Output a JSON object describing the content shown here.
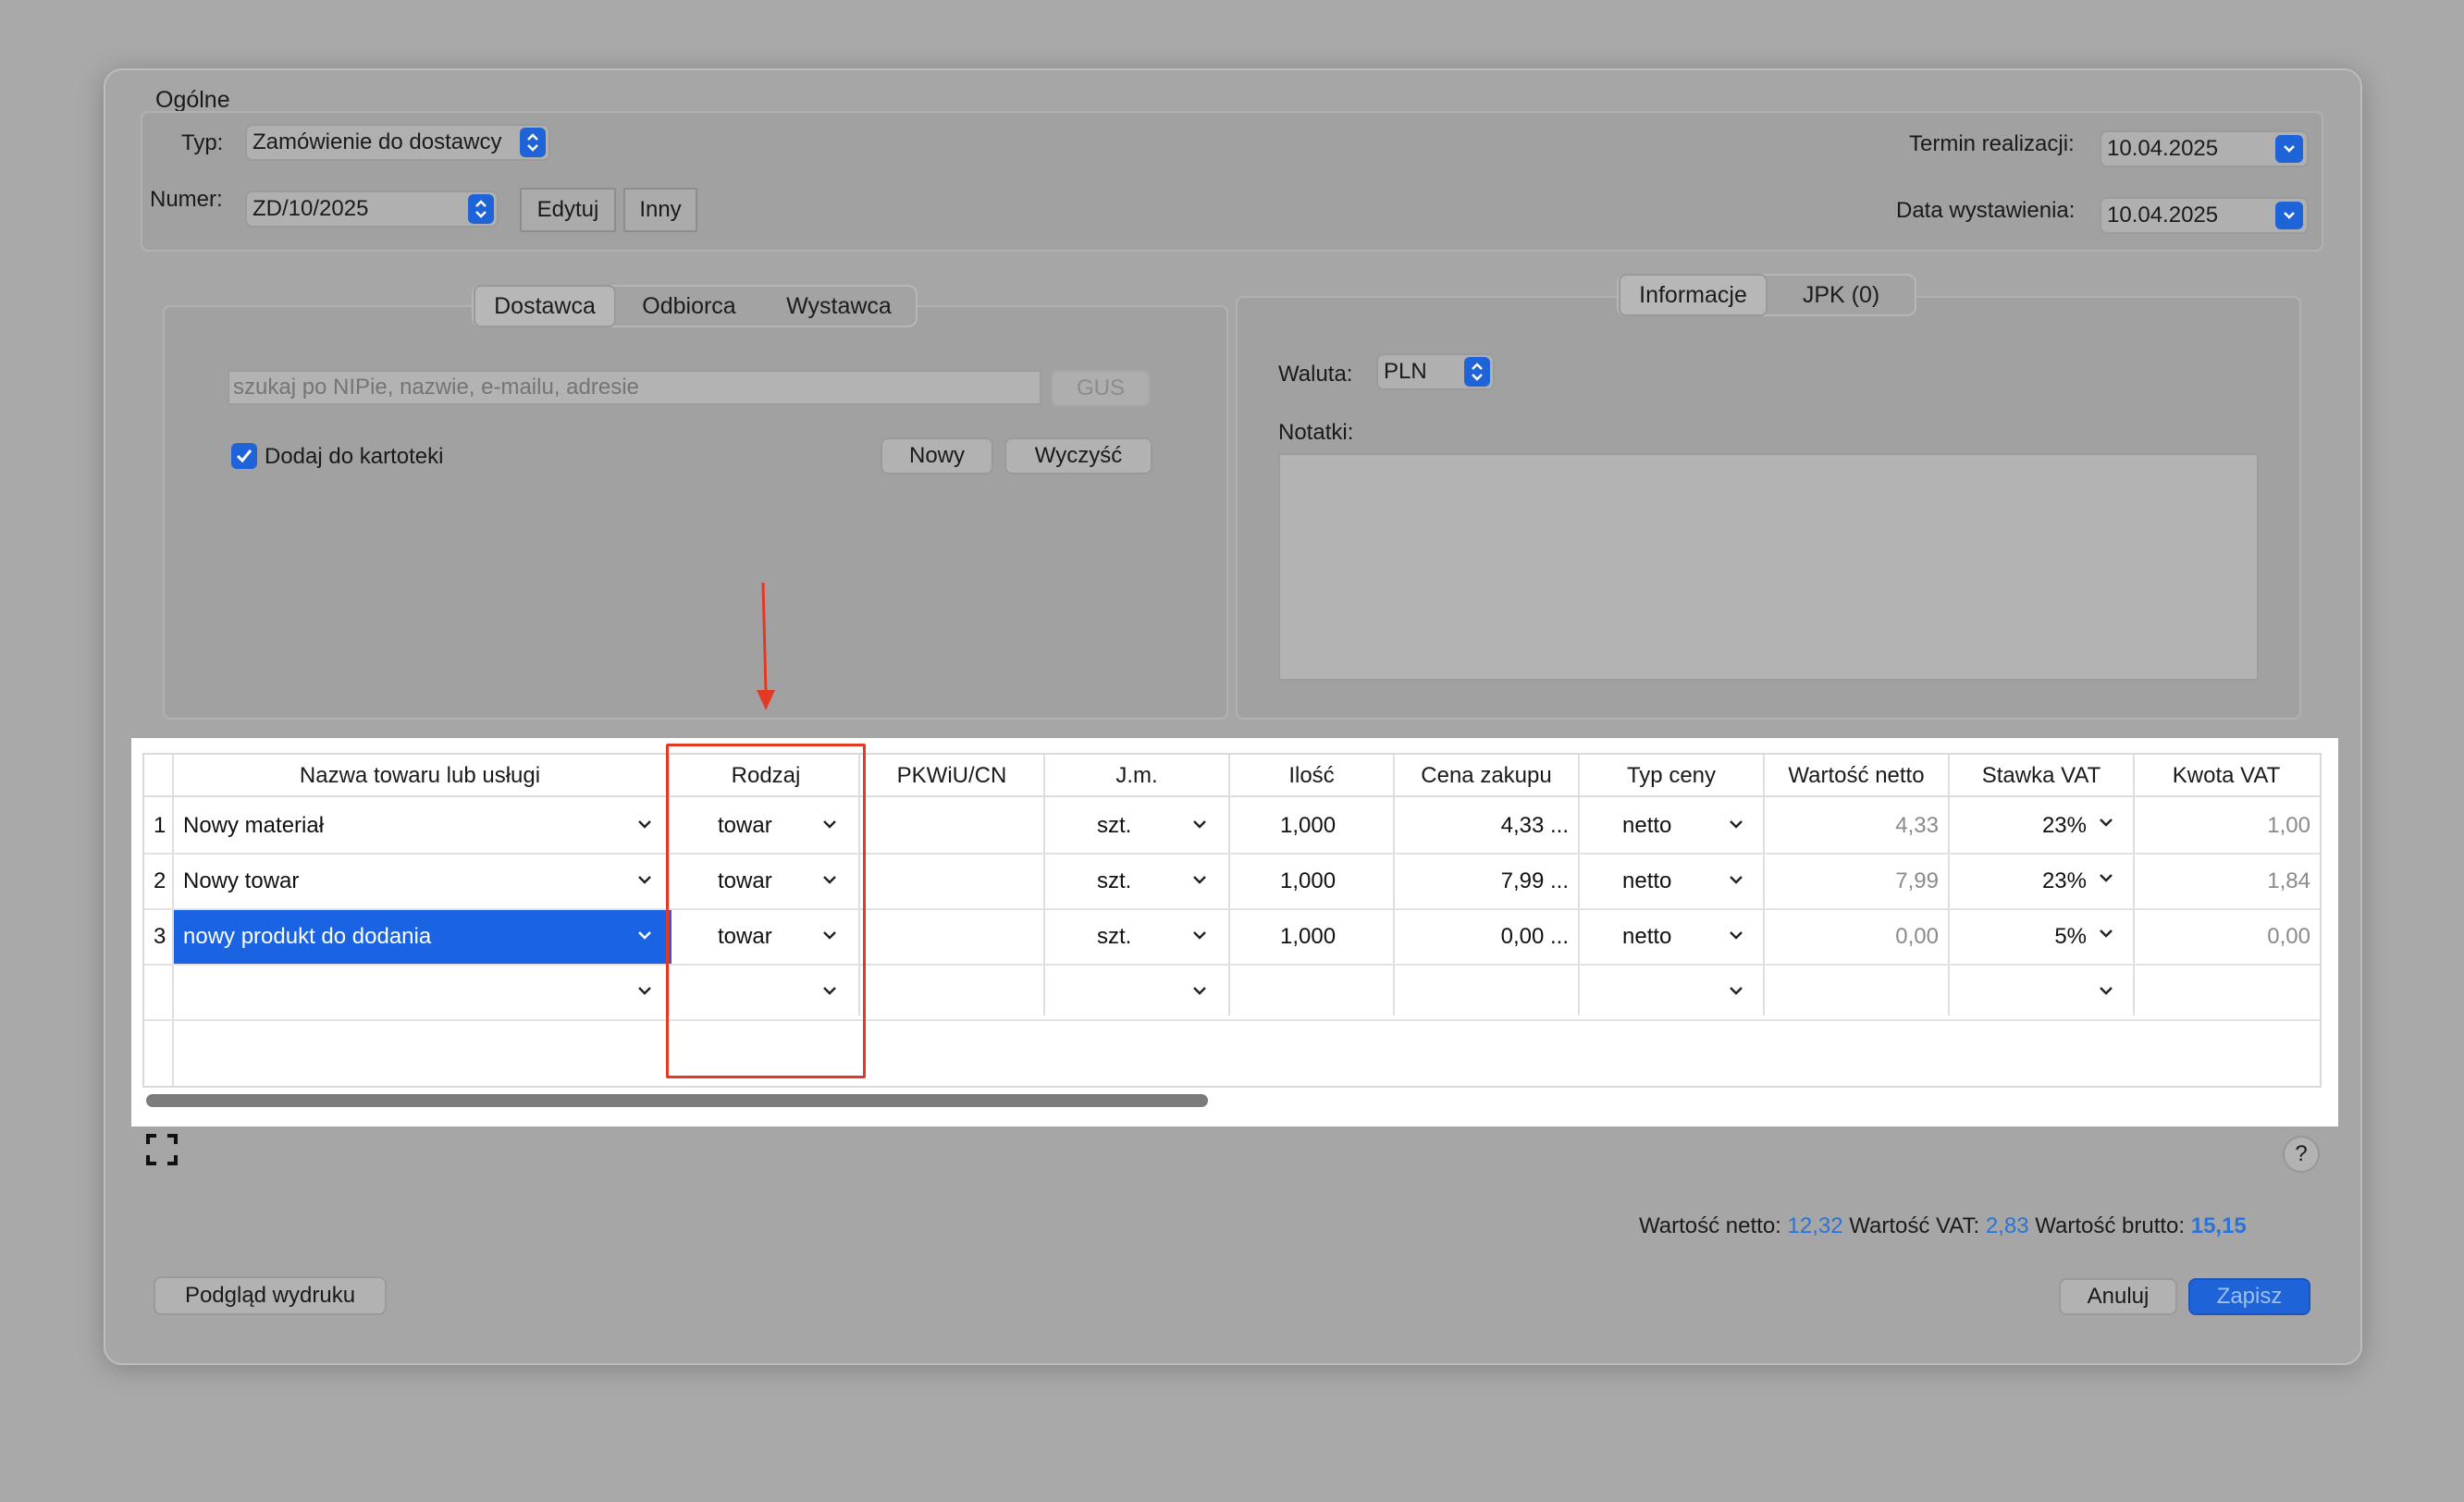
{
  "general": {
    "section_title": "Ogólne",
    "typ_label": "Typ:",
    "typ_value": "Zamówienie do dostawcy",
    "numer_label": "Numer:",
    "numer_value": "ZD/10/2025",
    "edytuj_label": "Edytuj",
    "inny_label": "Inny",
    "termin_label": "Termin realizacji:",
    "termin_value": "10.04.2025",
    "data_wyst_label": "Data wystawienia:",
    "data_wyst_value": "10.04.2025"
  },
  "party_tabs": [
    "Dostawca",
    "Odbiorca",
    "Wystawca"
  ],
  "party": {
    "search_placeholder": "szukaj po NIPie, nazwie, e-mailu, adresie",
    "gus_label": "GUS",
    "dodaj_label": "Dodaj do kartoteki",
    "dodaj_checked": true,
    "nowy_label": "Nowy",
    "wyczysc_label": "Wyczyść"
  },
  "info_tabs": [
    "Informacje",
    "JPK (0)"
  ],
  "info": {
    "waluta_label": "Waluta:",
    "waluta_value": "PLN",
    "notatki_label": "Notatki:"
  },
  "table": {
    "columns": [
      "Nazwa towaru lub usługi",
      "Rodzaj",
      "PKWiU/CN",
      "J.m.",
      "Ilość",
      "Cena zakupu",
      "Typ ceny",
      "Wartość netto",
      "Stawka VAT",
      "Kwota VAT"
    ],
    "rows": [
      {
        "num": "1",
        "name": "Nowy materiał",
        "rodzaj": "towar",
        "pkwiu": "",
        "jm": "szt.",
        "ilosc": "1,000",
        "cena": "4,33 ...",
        "typ": "netto",
        "netto": "4,33",
        "vat": "23%",
        "kwota": "1,00"
      },
      {
        "num": "2",
        "name": "Nowy towar",
        "rodzaj": "towar",
        "pkwiu": "",
        "jm": "szt.",
        "ilosc": "1,000",
        "cena": "7,99 ...",
        "typ": "netto",
        "netto": "7,99",
        "vat": "23%",
        "kwota": "1,84"
      },
      {
        "num": "3",
        "name": "nowy produkt do dodania",
        "rodzaj": "towar",
        "pkwiu": "",
        "jm": "szt.",
        "ilosc": "1,000",
        "cena": "0,00 ...",
        "typ": "netto",
        "netto": "0,00",
        "vat": "5%",
        "kwota": "0,00"
      }
    ]
  },
  "totals": {
    "netto_label": "Wartość netto:",
    "netto_value": "12,32",
    "vat_label": "Wartość VAT:",
    "vat_value": "2,83",
    "brutto_label": "Wartość brutto:",
    "brutto_value": "15,15"
  },
  "footer": {
    "preview_label": "Podgląd wydruku",
    "cancel_label": "Anuluj",
    "save_label": "Zapisz",
    "help_label": "?"
  },
  "colors": {
    "accent": "#1f63d8",
    "annotation": "#e23a25",
    "total_value": "#2a73d9"
  }
}
